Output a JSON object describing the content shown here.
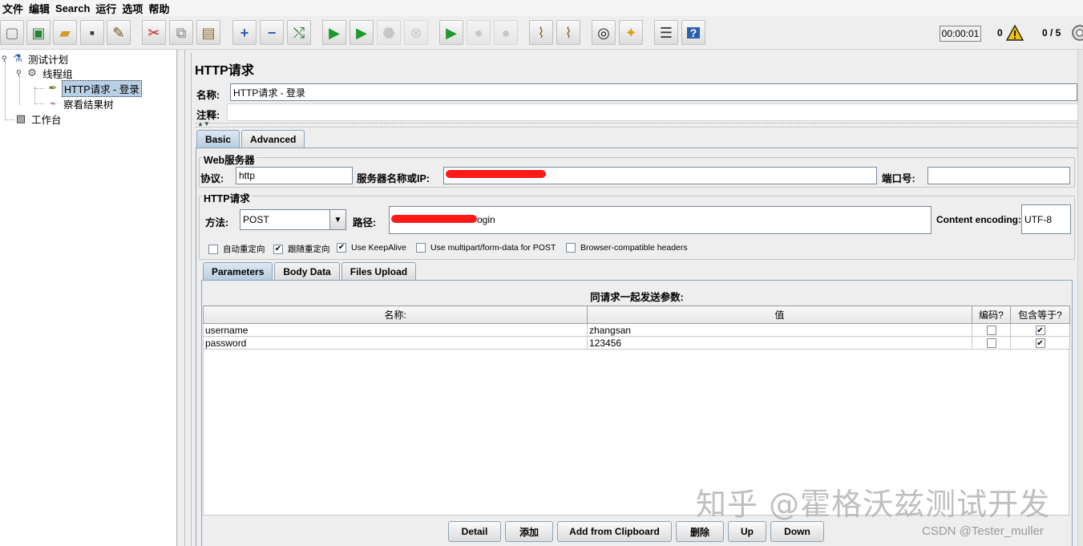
{
  "menu": [
    "文件",
    "编辑",
    "Search",
    "运行",
    "选项",
    "帮助"
  ],
  "toolbar": {
    "buttons": [
      {
        "name": "new-icon",
        "glyph": "🗋"
      },
      {
        "name": "templates-icon",
        "glyph": "▣"
      },
      {
        "name": "open-icon",
        "glyph": "📂"
      },
      {
        "name": "save-icon",
        "glyph": "💾"
      },
      {
        "name": "save-as-icon",
        "glyph": "✎"
      },
      {
        "name": "cut-icon",
        "glyph": "✂"
      },
      {
        "name": "copy-icon",
        "glyph": "⧉"
      },
      {
        "name": "paste-icon",
        "glyph": "📋"
      },
      {
        "name": "expand-icon",
        "glyph": "+"
      },
      {
        "name": "collapse-icon",
        "glyph": "−"
      },
      {
        "name": "toggle-icon",
        "glyph": "⤭"
      },
      {
        "name": "start-icon",
        "glyph": "▶"
      },
      {
        "name": "start-no-pause-icon",
        "glyph": "▶"
      },
      {
        "name": "stop-icon",
        "glyph": "⛔"
      },
      {
        "name": "shutdown-icon",
        "glyph": "⊗"
      },
      {
        "name": "remote-start-icon",
        "glyph": "▶"
      },
      {
        "name": "remote-stop-icon",
        "glyph": "●"
      },
      {
        "name": "remote-shutdown-icon",
        "glyph": "●"
      },
      {
        "name": "clear-icon",
        "glyph": "🧹"
      },
      {
        "name": "clear-all-icon",
        "glyph": "🧹"
      },
      {
        "name": "search-icon",
        "glyph": "🔭"
      },
      {
        "name": "reset-search-icon",
        "glyph": "🧽"
      },
      {
        "name": "function-helper-icon",
        "glyph": "☰"
      },
      {
        "name": "help-icon",
        "glyph": "?"
      }
    ],
    "timer": "00:00:01",
    "error_count": "0",
    "threads": "0 / 5"
  },
  "tree": {
    "items": [
      {
        "label": "测试计划",
        "icon": "test-plan-icon"
      },
      {
        "label": "线程组",
        "icon": "thread-group-icon"
      },
      {
        "label": "HTTP请求 - 登录",
        "icon": "http-sampler-icon"
      },
      {
        "label": "察看结果树",
        "icon": "results-tree-icon"
      },
      {
        "label": "工作台",
        "icon": "workbench-icon"
      }
    ]
  },
  "editor": {
    "title": "HTTP请求",
    "name_label": "名称:",
    "name_value": "HTTP请求 - 登录",
    "comment_label": "注释:",
    "comment_value": "",
    "tabs": [
      "Basic",
      "Advanced"
    ],
    "web_server": {
      "group_title": "Web服务器",
      "protocol_label": "协议:",
      "protocol_value": "http",
      "server_label": "服务器名称或IP:",
      "port_label": "端口号:",
      "port_value": ""
    },
    "http_request": {
      "group_title": "HTTP请求",
      "method_label": "方法:",
      "method_value": "POST",
      "path_label": "路径:",
      "path_visible_suffix": "ogin",
      "encoding_label": "Content encoding:",
      "encoding_value": "UTF-8"
    },
    "options": [
      {
        "label": "自动重定向",
        "checked": false
      },
      {
        "label": "跟随重定向",
        "checked": true
      },
      {
        "label": "Use KeepAlive",
        "checked": true
      },
      {
        "label": "Use multipart/form-data for POST",
        "checked": false
      },
      {
        "label": "Browser-compatible headers",
        "checked": false
      }
    ],
    "subtabs": [
      "Parameters",
      "Body Data",
      "Files Upload"
    ],
    "params_title": "同请求一起发送参数:",
    "columns": [
      "名称:",
      "值",
      "编码?",
      "包含等于?"
    ],
    "rows": [
      {
        "name": "username",
        "value": "zhangsan",
        "encode": false,
        "include_equals": true
      },
      {
        "name": "password",
        "value": "123456",
        "encode": false,
        "include_equals": true
      }
    ],
    "buttons": [
      "Detail",
      "添加",
      "Add from Clipboard",
      "删除",
      "Up",
      "Down"
    ]
  },
  "overlay": {
    "watermark": "知乎 @霍格沃兹测试开发",
    "credit": "CSDN @Tester_muller"
  }
}
